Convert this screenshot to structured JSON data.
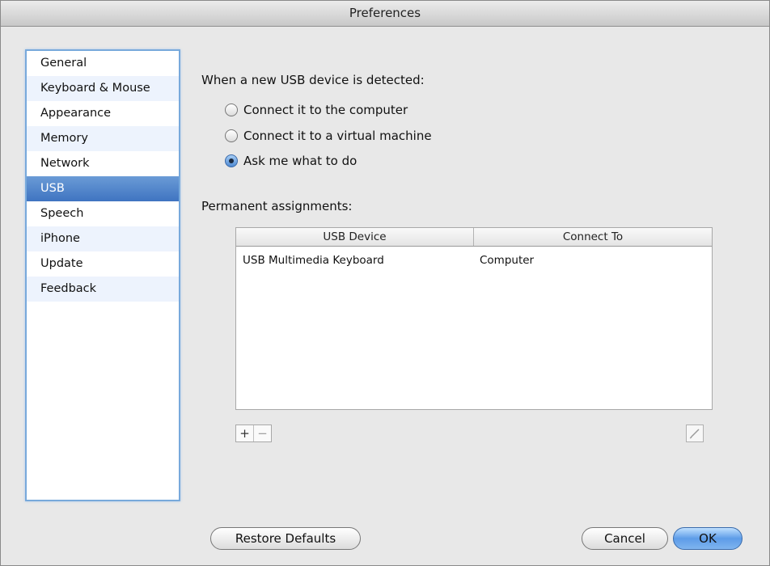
{
  "window": {
    "title": "Preferences"
  },
  "sidebar": {
    "items": [
      {
        "label": "General"
      },
      {
        "label": "Keyboard & Mouse"
      },
      {
        "label": "Appearance"
      },
      {
        "label": "Memory"
      },
      {
        "label": "Network"
      },
      {
        "label": "USB",
        "selected": true
      },
      {
        "label": "Speech"
      },
      {
        "label": "iPhone"
      },
      {
        "label": "Update"
      },
      {
        "label": "Feedback"
      }
    ]
  },
  "usb": {
    "heading": "When a new USB device is detected:",
    "options": [
      {
        "label": "Connect it to the computer",
        "checked": false
      },
      {
        "label": "Connect it to a virtual machine",
        "checked": false
      },
      {
        "label": "Ask me what to do",
        "checked": true
      }
    ],
    "assignments_label": "Permanent assignments:",
    "table": {
      "columns": [
        "USB Device",
        "Connect To"
      ],
      "rows": [
        [
          "USB Multimedia Keyboard",
          "Computer"
        ]
      ]
    },
    "add_label": "+",
    "remove_label": "−"
  },
  "footer": {
    "restore_label": "Restore Defaults",
    "cancel_label": "Cancel",
    "ok_label": "OK"
  },
  "colors": {
    "selection": "#3f74c1",
    "default_button": "#5d9ce8",
    "sidebar_border": "#78a9db"
  },
  "icons": {
    "edit": "pencil-icon"
  }
}
